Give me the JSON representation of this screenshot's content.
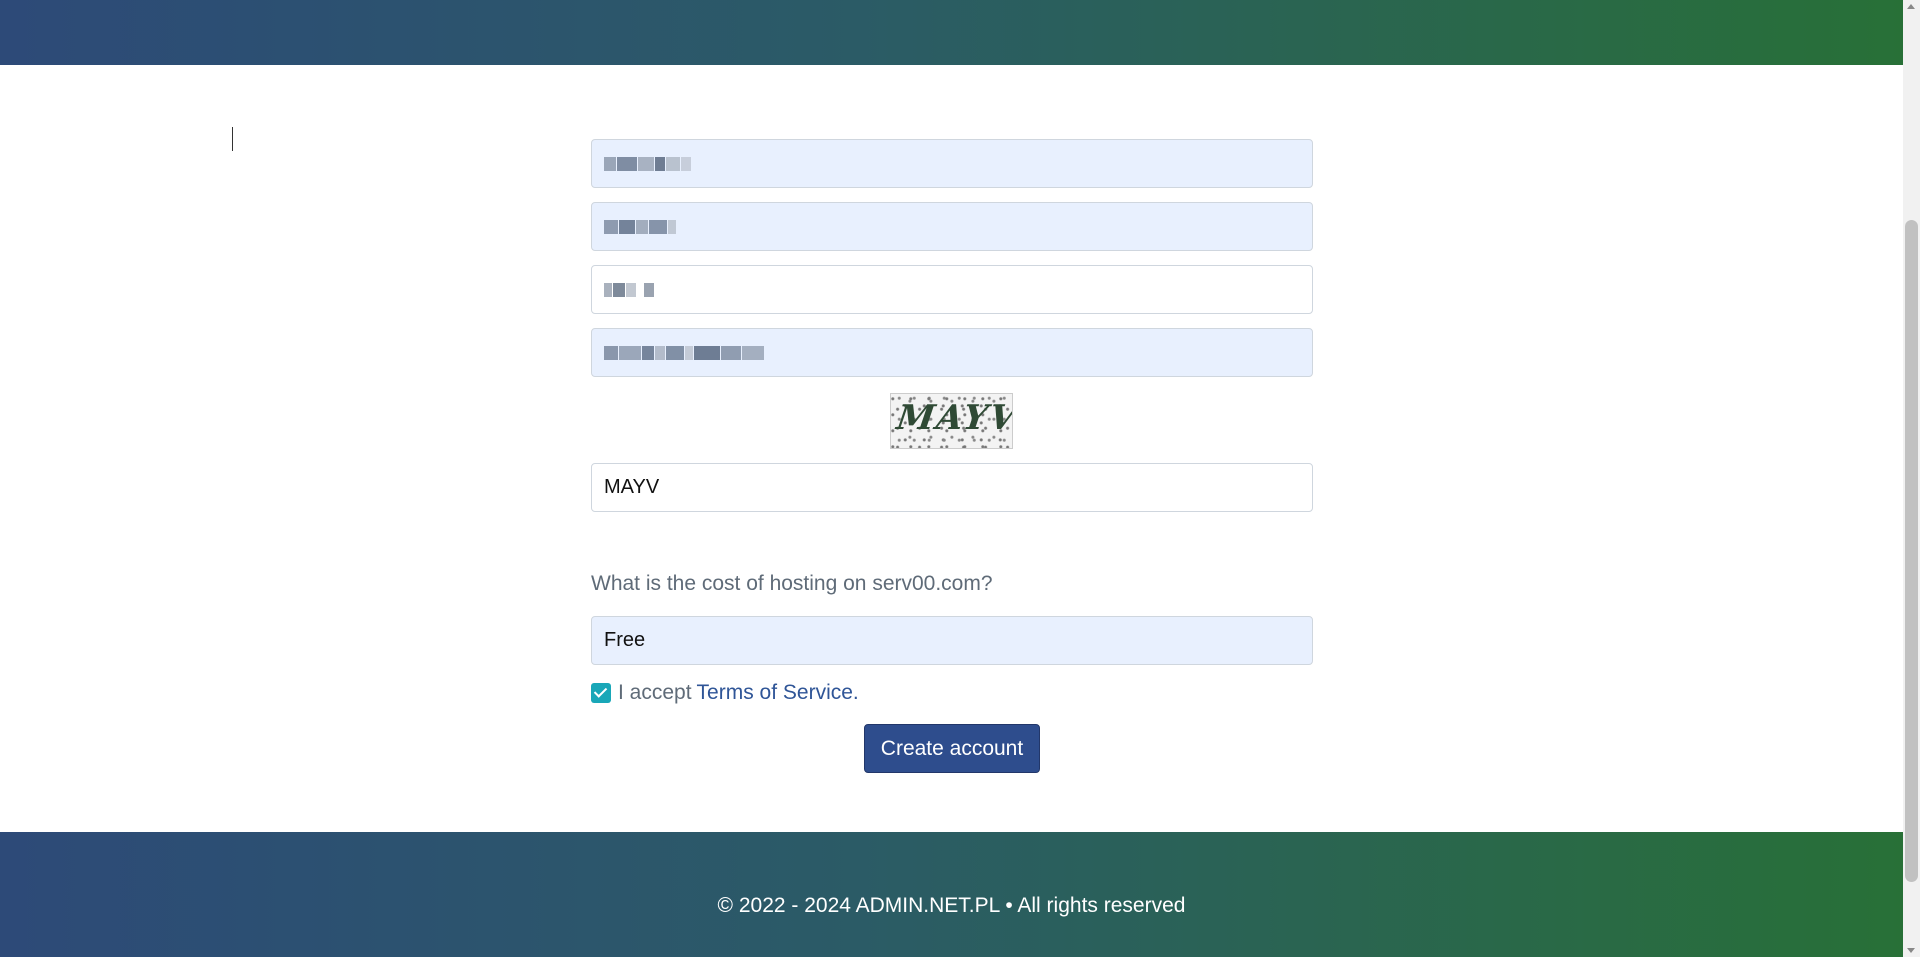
{
  "form": {
    "captcha_input_value": "MAYV",
    "captcha_image_text": "MAYV",
    "question_label": "What is the cost of hosting on serv00.com?",
    "answer_value": "Free",
    "terms_prefix": "I accept",
    "terms_link": "Terms of Service.",
    "terms_checked": true,
    "submit_label": "Create account"
  },
  "footer": {
    "copyright": "© 2022 - 2024 ADMIN.NET.PL • All rights reserved"
  },
  "colors": {
    "banner_start": "#2d4a78",
    "banner_end": "#287037",
    "autofill_bg": "#e8f0fe",
    "button_bg": "#2e4d8d",
    "checkbox_bg": "#19a7b8",
    "link": "#2f5597"
  }
}
